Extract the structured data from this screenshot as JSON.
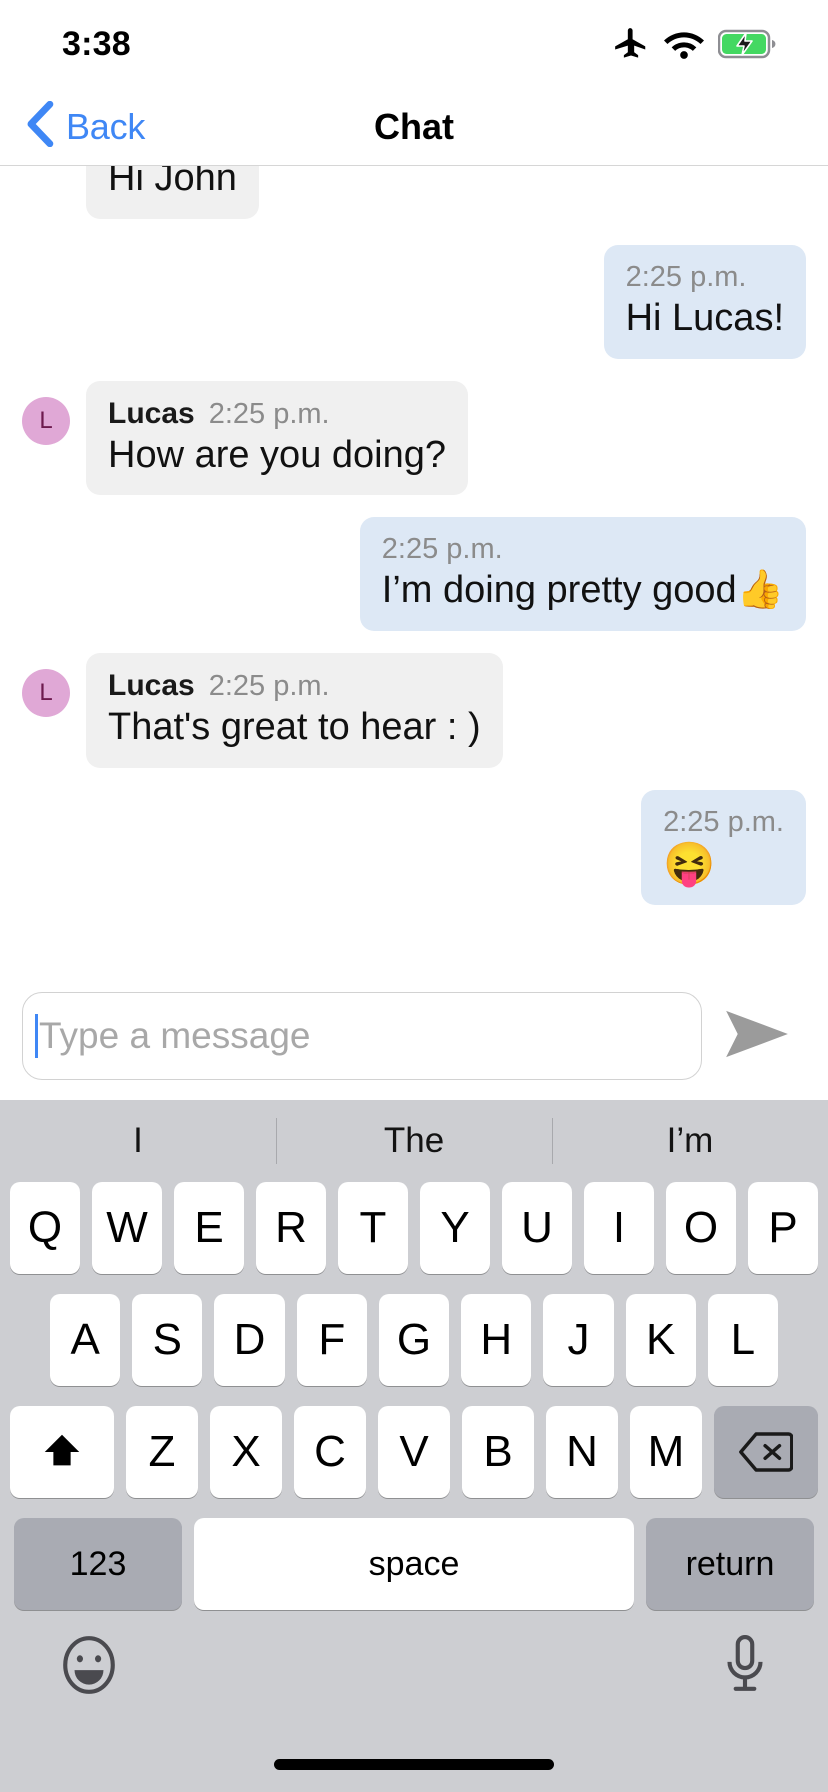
{
  "status_bar": {
    "time": "3:38",
    "icons": [
      "airplane-mode-icon",
      "wifi-icon",
      "battery-charging-icon"
    ]
  },
  "nav_bar": {
    "back_label": "Back",
    "title": "Chat"
  },
  "conversation": {
    "messages": [
      {
        "side": "left",
        "sender": "",
        "time": "",
        "text": "Hi John",
        "clipped": true,
        "avatar": ""
      },
      {
        "side": "right",
        "sender": "",
        "time": "2:25 p.m.",
        "text": "Hi Lucas!",
        "clipped": false,
        "avatar": ""
      },
      {
        "side": "left",
        "sender": "Lucas",
        "time": "2:25 p.m.",
        "text": "How are you doing?",
        "clipped": false,
        "avatar": "L"
      },
      {
        "side": "right",
        "sender": "",
        "time": "2:25 p.m.",
        "text": "I’m doing pretty good👍",
        "clipped": false,
        "avatar": ""
      },
      {
        "side": "left",
        "sender": "Lucas",
        "time": "2:25 p.m.",
        "text": "That's great to hear : )",
        "clipped": false,
        "avatar": "L"
      },
      {
        "side": "right",
        "sender": "",
        "time": "2:25 p.m.",
        "text": "😝",
        "clipped": false,
        "avatar": ""
      }
    ]
  },
  "input_bar": {
    "value": "",
    "placeholder": "Type a message",
    "send_icon": "send-arrow-icon"
  },
  "keyboard": {
    "suggestions": [
      "I",
      "The",
      "I’m"
    ],
    "row1": [
      "Q",
      "W",
      "E",
      "R",
      "T",
      "Y",
      "U",
      "I",
      "O",
      "P"
    ],
    "row2": [
      "A",
      "S",
      "D",
      "F",
      "G",
      "H",
      "J",
      "K",
      "L"
    ],
    "row3": [
      "Z",
      "X",
      "C",
      "V",
      "B",
      "N",
      "M"
    ],
    "shift_label": "⬆",
    "backspace_label": "⌫",
    "num_label": "123",
    "space_label": "space",
    "return_label": "return",
    "emoji_icon": "emoji-smiley-icon",
    "mic_icon": "microphone-icon"
  },
  "colors": {
    "accent_blue": "#3f87f5",
    "incoming_bubble": "#f0f0f0",
    "outgoing_bubble": "#dde8f5",
    "avatar_bg": "#e0a8d6",
    "avatar_text": "#6d1a4e",
    "keyboard_bg": "#cdced2",
    "key_dark": "#a9abb3"
  }
}
